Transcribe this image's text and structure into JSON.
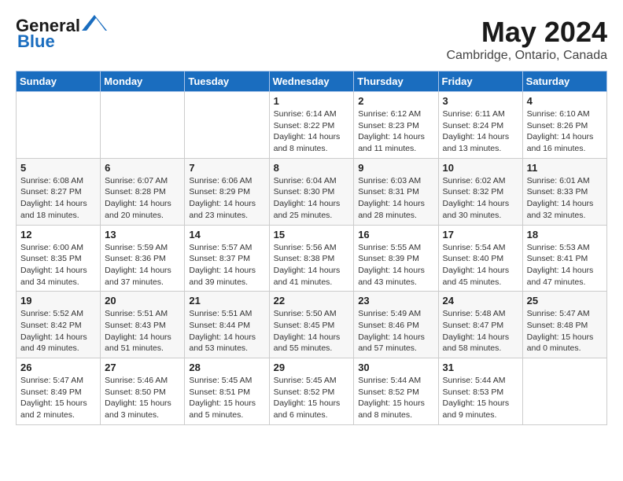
{
  "header": {
    "logo_line1": "General",
    "logo_line2": "Blue",
    "month": "May 2024",
    "location": "Cambridge, Ontario, Canada"
  },
  "weekdays": [
    "Sunday",
    "Monday",
    "Tuesday",
    "Wednesday",
    "Thursday",
    "Friday",
    "Saturday"
  ],
  "weeks": [
    [
      {
        "day": "",
        "sunrise": "",
        "sunset": "",
        "daylight": ""
      },
      {
        "day": "",
        "sunrise": "",
        "sunset": "",
        "daylight": ""
      },
      {
        "day": "",
        "sunrise": "",
        "sunset": "",
        "daylight": ""
      },
      {
        "day": "1",
        "sunrise": "Sunrise: 6:14 AM",
        "sunset": "Sunset: 8:22 PM",
        "daylight": "Daylight: 14 hours and 8 minutes."
      },
      {
        "day": "2",
        "sunrise": "Sunrise: 6:12 AM",
        "sunset": "Sunset: 8:23 PM",
        "daylight": "Daylight: 14 hours and 11 minutes."
      },
      {
        "day": "3",
        "sunrise": "Sunrise: 6:11 AM",
        "sunset": "Sunset: 8:24 PM",
        "daylight": "Daylight: 14 hours and 13 minutes."
      },
      {
        "day": "4",
        "sunrise": "Sunrise: 6:10 AM",
        "sunset": "Sunset: 8:26 PM",
        "daylight": "Daylight: 14 hours and 16 minutes."
      }
    ],
    [
      {
        "day": "5",
        "sunrise": "Sunrise: 6:08 AM",
        "sunset": "Sunset: 8:27 PM",
        "daylight": "Daylight: 14 hours and 18 minutes."
      },
      {
        "day": "6",
        "sunrise": "Sunrise: 6:07 AM",
        "sunset": "Sunset: 8:28 PM",
        "daylight": "Daylight: 14 hours and 20 minutes."
      },
      {
        "day": "7",
        "sunrise": "Sunrise: 6:06 AM",
        "sunset": "Sunset: 8:29 PM",
        "daylight": "Daylight: 14 hours and 23 minutes."
      },
      {
        "day": "8",
        "sunrise": "Sunrise: 6:04 AM",
        "sunset": "Sunset: 8:30 PM",
        "daylight": "Daylight: 14 hours and 25 minutes."
      },
      {
        "day": "9",
        "sunrise": "Sunrise: 6:03 AM",
        "sunset": "Sunset: 8:31 PM",
        "daylight": "Daylight: 14 hours and 28 minutes."
      },
      {
        "day": "10",
        "sunrise": "Sunrise: 6:02 AM",
        "sunset": "Sunset: 8:32 PM",
        "daylight": "Daylight: 14 hours and 30 minutes."
      },
      {
        "day": "11",
        "sunrise": "Sunrise: 6:01 AM",
        "sunset": "Sunset: 8:33 PM",
        "daylight": "Daylight: 14 hours and 32 minutes."
      }
    ],
    [
      {
        "day": "12",
        "sunrise": "Sunrise: 6:00 AM",
        "sunset": "Sunset: 8:35 PM",
        "daylight": "Daylight: 14 hours and 34 minutes."
      },
      {
        "day": "13",
        "sunrise": "Sunrise: 5:59 AM",
        "sunset": "Sunset: 8:36 PM",
        "daylight": "Daylight: 14 hours and 37 minutes."
      },
      {
        "day": "14",
        "sunrise": "Sunrise: 5:57 AM",
        "sunset": "Sunset: 8:37 PM",
        "daylight": "Daylight: 14 hours and 39 minutes."
      },
      {
        "day": "15",
        "sunrise": "Sunrise: 5:56 AM",
        "sunset": "Sunset: 8:38 PM",
        "daylight": "Daylight: 14 hours and 41 minutes."
      },
      {
        "day": "16",
        "sunrise": "Sunrise: 5:55 AM",
        "sunset": "Sunset: 8:39 PM",
        "daylight": "Daylight: 14 hours and 43 minutes."
      },
      {
        "day": "17",
        "sunrise": "Sunrise: 5:54 AM",
        "sunset": "Sunset: 8:40 PM",
        "daylight": "Daylight: 14 hours and 45 minutes."
      },
      {
        "day": "18",
        "sunrise": "Sunrise: 5:53 AM",
        "sunset": "Sunset: 8:41 PM",
        "daylight": "Daylight: 14 hours and 47 minutes."
      }
    ],
    [
      {
        "day": "19",
        "sunrise": "Sunrise: 5:52 AM",
        "sunset": "Sunset: 8:42 PM",
        "daylight": "Daylight: 14 hours and 49 minutes."
      },
      {
        "day": "20",
        "sunrise": "Sunrise: 5:51 AM",
        "sunset": "Sunset: 8:43 PM",
        "daylight": "Daylight: 14 hours and 51 minutes."
      },
      {
        "day": "21",
        "sunrise": "Sunrise: 5:51 AM",
        "sunset": "Sunset: 8:44 PM",
        "daylight": "Daylight: 14 hours and 53 minutes."
      },
      {
        "day": "22",
        "sunrise": "Sunrise: 5:50 AM",
        "sunset": "Sunset: 8:45 PM",
        "daylight": "Daylight: 14 hours and 55 minutes."
      },
      {
        "day": "23",
        "sunrise": "Sunrise: 5:49 AM",
        "sunset": "Sunset: 8:46 PM",
        "daylight": "Daylight: 14 hours and 57 minutes."
      },
      {
        "day": "24",
        "sunrise": "Sunrise: 5:48 AM",
        "sunset": "Sunset: 8:47 PM",
        "daylight": "Daylight: 14 hours and 58 minutes."
      },
      {
        "day": "25",
        "sunrise": "Sunrise: 5:47 AM",
        "sunset": "Sunset: 8:48 PM",
        "daylight": "Daylight: 15 hours and 0 minutes."
      }
    ],
    [
      {
        "day": "26",
        "sunrise": "Sunrise: 5:47 AM",
        "sunset": "Sunset: 8:49 PM",
        "daylight": "Daylight: 15 hours and 2 minutes."
      },
      {
        "day": "27",
        "sunrise": "Sunrise: 5:46 AM",
        "sunset": "Sunset: 8:50 PM",
        "daylight": "Daylight: 15 hours and 3 minutes."
      },
      {
        "day": "28",
        "sunrise": "Sunrise: 5:45 AM",
        "sunset": "Sunset: 8:51 PM",
        "daylight": "Daylight: 15 hours and 5 minutes."
      },
      {
        "day": "29",
        "sunrise": "Sunrise: 5:45 AM",
        "sunset": "Sunset: 8:52 PM",
        "daylight": "Daylight: 15 hours and 6 minutes."
      },
      {
        "day": "30",
        "sunrise": "Sunrise: 5:44 AM",
        "sunset": "Sunset: 8:52 PM",
        "daylight": "Daylight: 15 hours and 8 minutes."
      },
      {
        "day": "31",
        "sunrise": "Sunrise: 5:44 AM",
        "sunset": "Sunset: 8:53 PM",
        "daylight": "Daylight: 15 hours and 9 minutes."
      },
      {
        "day": "",
        "sunrise": "",
        "sunset": "",
        "daylight": ""
      }
    ]
  ]
}
